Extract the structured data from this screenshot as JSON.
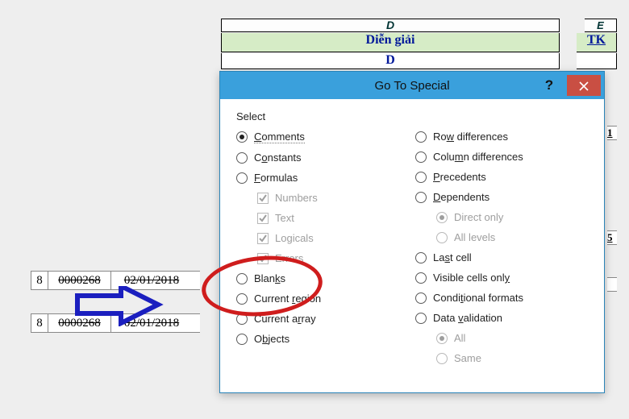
{
  "sheet": {
    "col_d": "D",
    "col_e": "E",
    "header_d": "Diễn giải",
    "header_e": "TK",
    "subheader": "D",
    "rows_left": [
      {
        "idx": "8",
        "code": "0000268",
        "date": "02/01/2018"
      },
      {
        "idx": "8",
        "code": "0000268",
        "date": "02/01/2018"
      }
    ],
    "peek1": "1",
    "peek2": "5",
    "peek3": ""
  },
  "dialog": {
    "title": "Go To Special",
    "help": "?",
    "group_label": "Select",
    "left": {
      "comments": "Comments",
      "constants": "Constants",
      "formulas": "Formulas",
      "numbers": "Numbers",
      "text": "Text",
      "logicals": "Logicals",
      "errors": "Errors",
      "blanks": "Blanks",
      "current_region": "Current region",
      "current_array": "Current array",
      "objects": "Objects"
    },
    "right": {
      "row_diff": "Row differences",
      "col_diff": "Column differences",
      "precedents": "Precedents",
      "dependents": "Dependents",
      "direct_only": "Direct only",
      "all_levels": "All levels",
      "last_cell": "Last cell",
      "visible": "Visible cells only",
      "cond_formats": "Conditional formats",
      "data_validation": "Data validation",
      "all": "All",
      "same": "Same"
    }
  }
}
